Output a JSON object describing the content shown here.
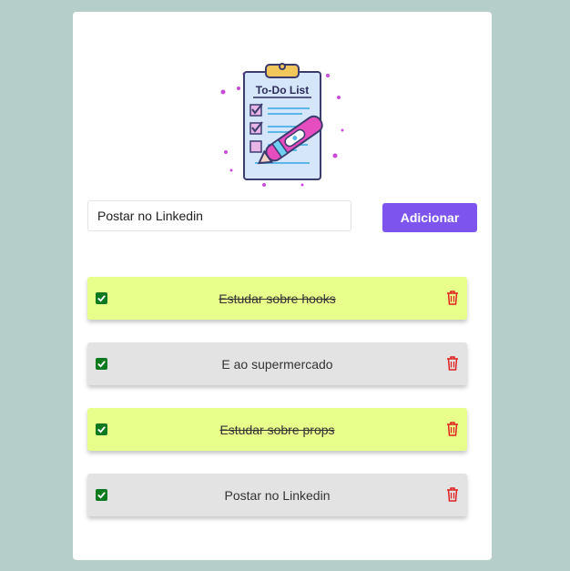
{
  "logo": {
    "text": "To-Do List",
    "icon": "clipboard-pen-icon"
  },
  "input": {
    "value": "Postar no Linkedin"
  },
  "add_button": {
    "label": "Adicionar"
  },
  "colors": {
    "accent": "#7d55ee",
    "done_background": "#e9ff8c",
    "pending_background": "#e3e3e3",
    "checkbox": "#0a7a1e",
    "delete": "#e02020",
    "page_background": "#b5cec9"
  },
  "todos": [
    {
      "text": "Estudar sobre hooks",
      "done": true,
      "checked": true
    },
    {
      "text": "E ao supermercado",
      "done": false,
      "checked": true
    },
    {
      "text": "Estudar sobre props",
      "done": true,
      "checked": true
    },
    {
      "text": "Postar no Linkedin",
      "done": false,
      "checked": true
    }
  ]
}
